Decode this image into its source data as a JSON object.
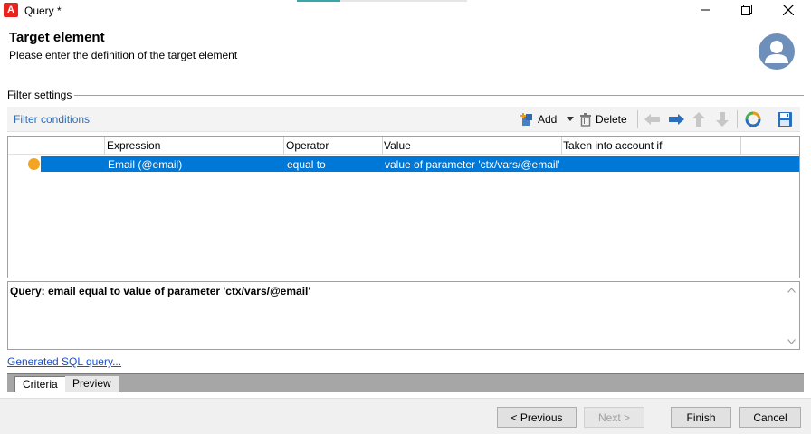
{
  "window": {
    "title": "Query *",
    "app_logo_letter": "A"
  },
  "header": {
    "title": "Target element",
    "subtitle": "Please enter the definition of the target element"
  },
  "filter_settings": {
    "label": "Filter settings",
    "toolbar": {
      "title": "Filter conditions",
      "add_label": "Add",
      "delete_label": "Delete"
    },
    "grid": {
      "columns": [
        "Expression",
        "Operator",
        "Value",
        "Taken into account if"
      ],
      "rows": [
        {
          "expression": "Email (@email)",
          "operator": "equal to",
          "value": "value of parameter 'ctx/vars/@email'",
          "taken_into_account_if": ""
        }
      ]
    },
    "query_text": "Query: email equal to value of parameter 'ctx/vars/@email'",
    "sql_link": "Generated SQL query..."
  },
  "tabs": [
    {
      "label": "Criteria",
      "active": true
    },
    {
      "label": "Preview",
      "active": false
    }
  ],
  "footer": {
    "previous_label": "< Previous",
    "next_label": "Next >",
    "finish_label": "Finish",
    "cancel_label": "Cancel"
  },
  "colors": {
    "selection": "#0078d7",
    "link": "#2f6db5",
    "accent_logo": "#e8231f",
    "status_dot": "#f2a524",
    "avatar": "#6d8fba"
  },
  "icons": [
    "adobe-logo-icon",
    "minimize-icon",
    "maximize-icon",
    "close-icon",
    "user-avatar-icon",
    "add-icon",
    "dropdown-arrow-icon",
    "trash-icon",
    "arrow-left-icon",
    "arrow-right-icon",
    "arrow-up-icon",
    "arrow-down-icon",
    "refresh-icon",
    "save-icon",
    "status-dot-icon",
    "scroll-up-icon",
    "scroll-down-icon"
  ]
}
